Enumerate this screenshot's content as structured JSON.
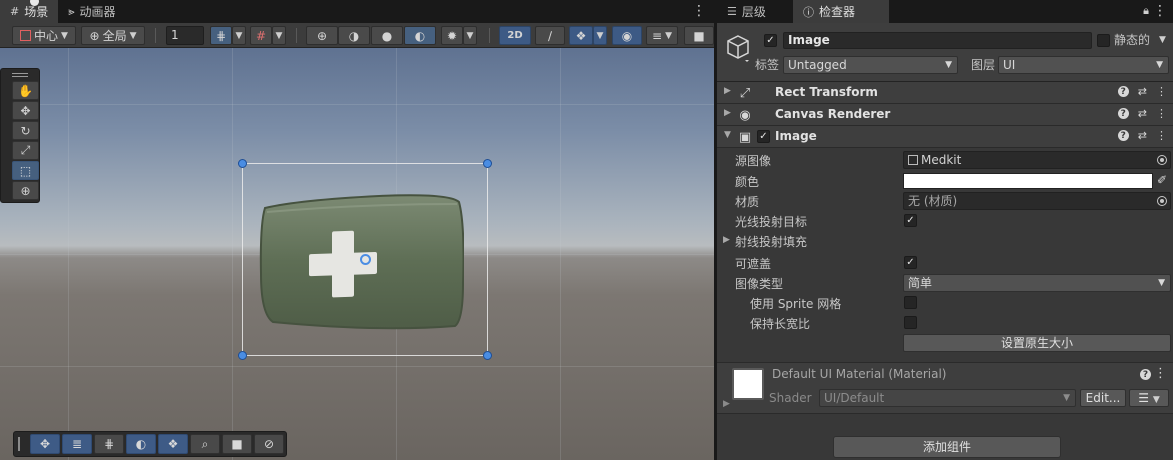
{
  "scene": {
    "tabs": [
      {
        "label": "场景",
        "icon": "grid-icon"
      },
      {
        "label": "动画器",
        "icon": "animator-icon"
      }
    ],
    "toolbar": {
      "pivot_label": "中心",
      "space_label": "全局",
      "grid_snap_value": "1",
      "mode_2d_label": "2D"
    }
  },
  "inspector": {
    "tabs": [
      {
        "label": "层级",
        "icon": "hierarchy-icon"
      },
      {
        "label": "检查器",
        "icon": "info-icon"
      }
    ],
    "object": {
      "name": "Image",
      "static_label": "静态的",
      "tag_label": "标签",
      "tag_value": "Untagged",
      "layer_label": "图层",
      "layer_value": "UI"
    },
    "components": [
      {
        "name": "Rect Transform"
      },
      {
        "name": "Canvas Renderer"
      },
      {
        "name": "Image"
      }
    ],
    "image_props": {
      "source_image_label": "源图像",
      "source_image_value": "Medkit",
      "color_label": "颜色",
      "color_value": "#ffffff",
      "material_label": "材质",
      "material_value": "无 (材质)",
      "raycast_target_label": "光线投射目标",
      "raycast_padding_label": "射线投射填充",
      "maskable_label": "可遮盖",
      "image_type_label": "图像类型",
      "image_type_value": "简单",
      "use_sprite_mesh_label": "使用 Sprite 网格",
      "preserve_aspect_label": "保持长宽比",
      "set_native_size_label": "设置原生大小"
    },
    "material": {
      "title": "Default UI Material (Material)",
      "shader_label": "Shader",
      "shader_value": "UI/Default",
      "edit_label": "Edit..."
    },
    "add_component_label": "添加组件"
  }
}
